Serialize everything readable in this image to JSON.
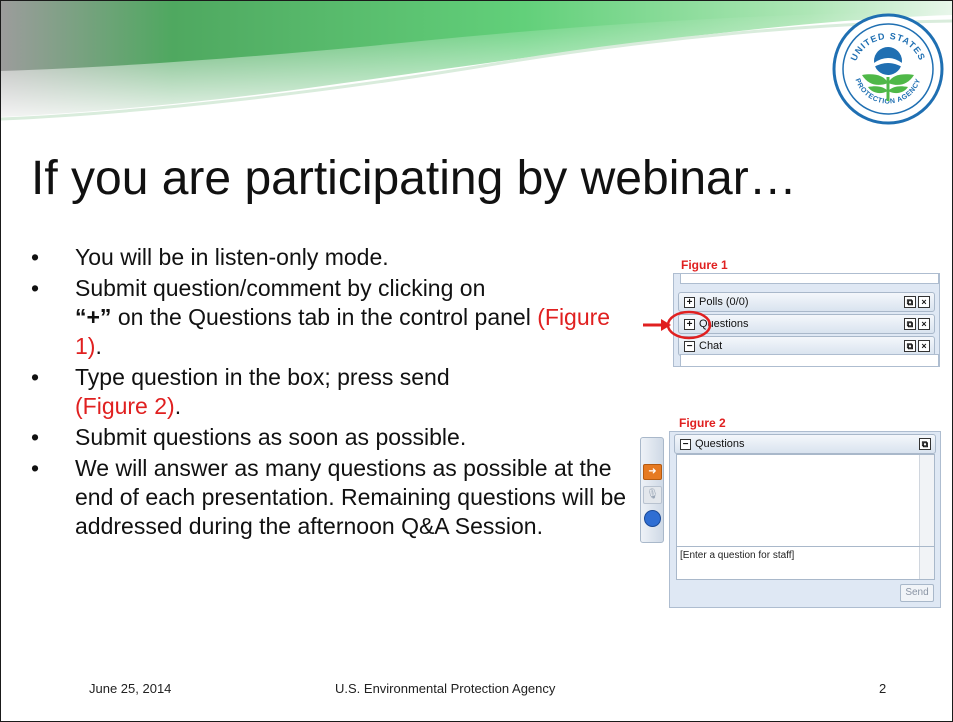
{
  "title": "If you are participating by webinar…",
  "bullets": {
    "b1": "You will be in listen-only mode.",
    "b2_pre": "Submit question/comment by clicking on",
    "b2_plus": "“+”",
    "b2_mid": "on the Questions tab in the control panel",
    "b2_ref": "(Figure 1)",
    "b2_end": ".",
    "b3_pre": "Type question in the box; press send",
    "b3_ref": "(Figure 2)",
    "b3_end": ".",
    "b4": "Submit questions as soon as possible.",
    "b5": "We will answer as many questions as possible at the end of each presentation. Remaining questions will be addressed during the afternoon Q&A Session."
  },
  "figure1": {
    "label": "Figure 1",
    "rows": [
      {
        "toggle": "+",
        "label": "Polls (0/0)"
      },
      {
        "toggle": "+",
        "label": "Questions"
      },
      {
        "toggle": "−",
        "label": "Chat"
      }
    ]
  },
  "figure2": {
    "label": "Figure 2",
    "header": "Questions",
    "toggle": "−",
    "placeholder": "[Enter a question for staff]",
    "send_label": "Send"
  },
  "seal": {
    "top_text": "UNITED STATES",
    "left_text": "ENVIRONMENTAL",
    "bottom_text": "PROTECTION AGENCY"
  },
  "footer": {
    "date": "June 25, 2014",
    "org": "U.S. Environmental Protection Agency",
    "page": "2"
  },
  "colors": {
    "accent_green": "#4fc26a",
    "seal_blue": "#1f6fb2",
    "highlight_red": "#e02020"
  }
}
